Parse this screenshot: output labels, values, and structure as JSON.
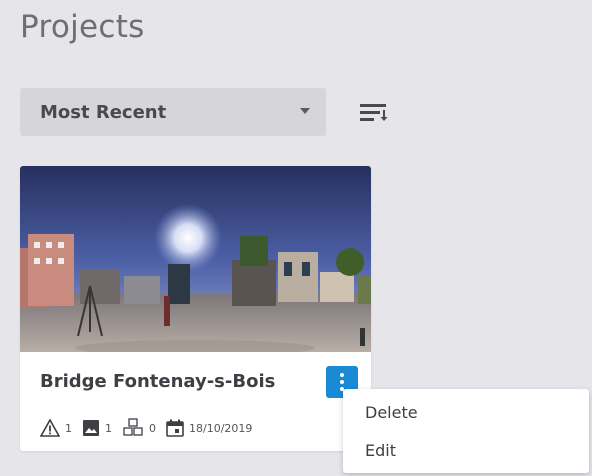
{
  "page": {
    "title": "Projects"
  },
  "sort": {
    "selected": "Most Recent",
    "icon": "sort-icon"
  },
  "project": {
    "title": "Bridge Fontenay-s-Bois",
    "stats": {
      "alerts": "1",
      "images": "1",
      "models": "0",
      "date": "18/10/2019"
    }
  },
  "context_menu": {
    "items": [
      {
        "label": "Delete"
      },
      {
        "label": "Edit"
      }
    ]
  },
  "colors": {
    "background": "#e6e5ea",
    "accent": "#1a8ad4",
    "card": "#ffffff",
    "text": "#3f3e44"
  }
}
